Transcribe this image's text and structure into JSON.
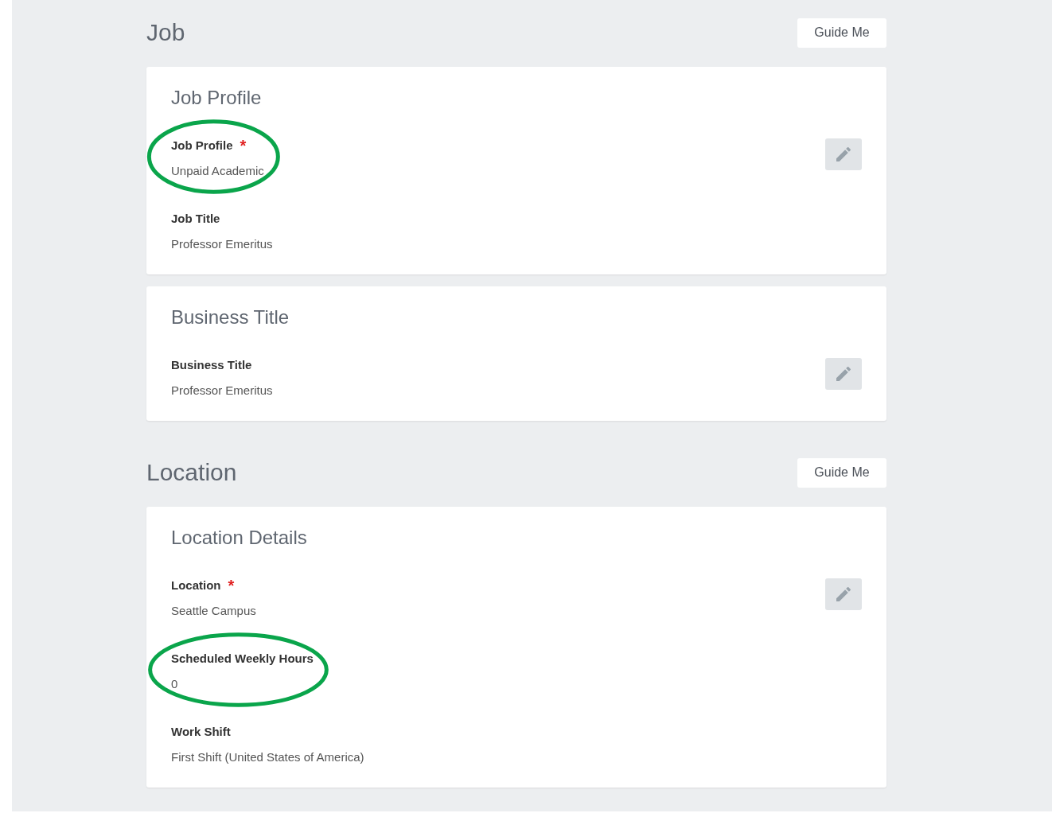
{
  "sections": [
    {
      "title": "Job",
      "guide_button": "Guide Me",
      "cards": [
        {
          "title": "Job Profile",
          "fields": [
            {
              "label": "Job Profile",
              "required_mark": "*",
              "value": "Unpaid Academic",
              "highlighted": true
            },
            {
              "label": "Job Title",
              "value": "Professor Emeritus",
              "highlighted": false
            }
          ]
        },
        {
          "title": "Business Title",
          "fields": [
            {
              "label": "Business Title",
              "value": "Professor Emeritus",
              "highlighted": false
            }
          ]
        }
      ]
    },
    {
      "title": "Location",
      "guide_button": "Guide Me",
      "cards": [
        {
          "title": "Location Details",
          "fields": [
            {
              "label": "Location",
              "required_mark": "*",
              "value": "Seattle Campus",
              "highlighted": false
            },
            {
              "label": "Scheduled Weekly Hours",
              "value": "0",
              "highlighted": true
            },
            {
              "label": "Work Shift",
              "value": "First Shift (United States of America)",
              "highlighted": false
            }
          ]
        }
      ]
    }
  ]
}
